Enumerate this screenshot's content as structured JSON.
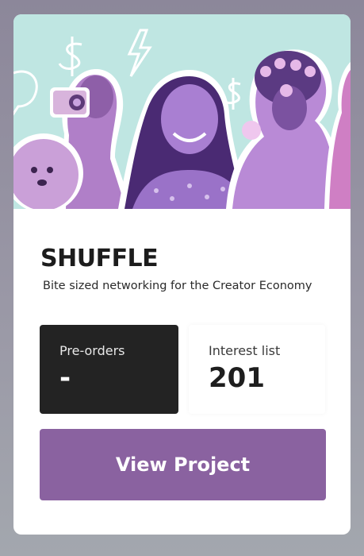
{
  "project": {
    "title": "SHUFFLE",
    "subtitle": "Bite sized networking for the Creator Economy"
  },
  "stats": {
    "preorders_label": "Pre-orders",
    "preorders_value": "-",
    "interest_label": "Interest list",
    "interest_value": "201"
  },
  "cta": {
    "label": "View Project"
  },
  "hero": {
    "image": "collage-of-smiling-creators",
    "icons": [
      "dollar-icon",
      "lightning-icon",
      "dollar-icon",
      "speech-bubble-icon"
    ]
  },
  "colors": {
    "accent": "#8a62a0",
    "dark_box": "#232323",
    "hero_bg": "#bfe6e2",
    "purple_tint": "#9b6fc0"
  }
}
